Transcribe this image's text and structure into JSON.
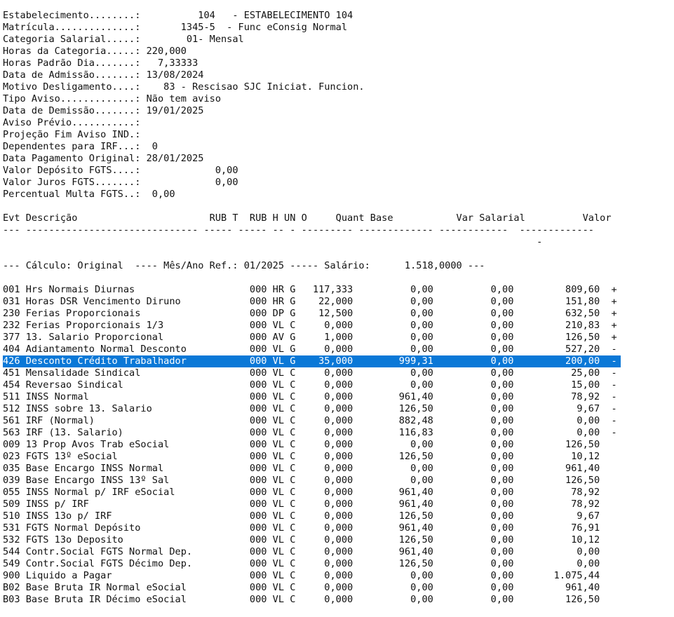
{
  "header_lines": [
    "Estabelecimento........:          104   - ESTABELECIMENTO 104",
    "Matrícula..............:       1345-5  - Func eConsig Normal",
    "Categoria Salarial.....:        01- Mensal",
    "Horas da Categoria.....: 220,000",
    "Horas Padrão Dia.......:   7,33333",
    "Data de Admissão.......: 13/08/2024",
    "Motivo Desligamento....:    83 - Rescisao SJC Iniciat. Funcion.",
    "Tipo Aviso.............: Não tem aviso",
    "Data de Demissão.......: 19/01/2025",
    "Aviso Prévio...........:",
    "Projeção Fim Aviso IND.:",
    "Dependentes para IRF...:  0",
    "Data Pagamento Original: 28/01/2025",
    "Valor Depósito FGTS....:             0,00",
    "Valor Juros FGTS.......:             0,00",
    "Percentual Multa FGTS..:  0,00"
  ],
  "blank_after_header": "",
  "column_header": "Evt Descrição                       RUB T  RUB H UN O     Quant Base           Var Salarial          Valor",
  "column_rule": "--- ------------------------------ ----- ----- -- - --------- ------------- ------------  -------------",
  "rule_tail": "                                                                                             -",
  "blank_before_calc": "",
  "calc_line": "--- Cálculo: Original  ---- Mês/Ano Ref.: 01/2025 ----- Salário:      1.518,0000 ---",
  "blank_after_calc": "",
  "rows": [
    {
      "text": "001 Hrs Normais Diurnas                    000 HR G   117,333          0,00          0,00         809,60  +",
      "selected": false
    },
    {
      "text": "031 Horas DSR Vencimento Diruno            000 HR G    22,000          0,00          0,00         151,80  +",
      "selected": false
    },
    {
      "text": "230 Ferias Proporcionais                   000 DP G    12,500          0,00          0,00         632,50  +",
      "selected": false
    },
    {
      "text": "232 Ferias Proporcionais 1/3               000 VL C     0,000          0,00          0,00         210,83  +",
      "selected": false
    },
    {
      "text": "377 13. Salario Proporcional               000 AV G     1,000          0,00          0,00         126,50  +",
      "selected": false
    },
    {
      "text": "404 Adiantamento Normal Desconto           000 VL G     0,000          0,00          0,00         527,20  -",
      "selected": false
    },
    {
      "text": "426 Desconto Crédito Trabalhador           000 VL G    35,000        999,31          0,00         200,00  -",
      "selected": true
    },
    {
      "text": "451 Mensalidade Sindical                   000 VL C     0,000          0,00          0,00          25,00  -",
      "selected": false
    },
    {
      "text": "454 Reversao Sindical                      000 VL C     0,000          0,00          0,00          15,00  -",
      "selected": false
    },
    {
      "text": "511 INSS Normal                            000 VL C     0,000        961,40          0,00          78,92  -",
      "selected": false
    },
    {
      "text": "512 INSS sobre 13. Salario                 000 VL C     0,000        126,50          0,00           9,67  -",
      "selected": false
    },
    {
      "text": "561 IRF (Normal)                           000 VL C     0,000        882,48          0,00           0,00  -",
      "selected": false
    },
    {
      "text": "563 IRF (13. Salario)                      000 VL C     0,000        116,83          0,00           0,00  -",
      "selected": false
    },
    {
      "text": "009 13 Prop Avos Trab eSocial              000 VL C     0,000          0,00          0,00         126,50",
      "selected": false
    },
    {
      "text": "023 FGTS 13º eSocial                       000 VL C     0,000        126,50          0,00          10,12",
      "selected": false
    },
    {
      "text": "035 Base Encargo INSS Normal               000 VL C     0,000          0,00          0,00         961,40",
      "selected": false
    },
    {
      "text": "039 Base Encargo INSS 13º Sal              000 VL C     0,000          0,00          0,00         126,50",
      "selected": false
    },
    {
      "text": "055 INSS Normal p/ IRF eSocial             000 VL C     0,000        961,40          0,00          78,92",
      "selected": false
    },
    {
      "text": "509 INSS p/ IRF                            000 VL C     0,000        961,40          0,00          78,92",
      "selected": false
    },
    {
      "text": "510 INSS 13o p/ IRF                        000 VL C     0,000        126,50          0,00           9,67",
      "selected": false
    },
    {
      "text": "531 FGTS Normal Depósito                   000 VL C     0,000        961,40          0,00          76,91",
      "selected": false
    },
    {
      "text": "532 FGTS 13o Deposito                      000 VL C     0,000        126,50          0,00          10,12",
      "selected": false
    },
    {
      "text": "544 Contr.Social FGTS Normal Dep.          000 VL C     0,000        961,40          0,00           0,00",
      "selected": false
    },
    {
      "text": "549 Contr.Social FGTS Décimo Dep.          000 VL C     0,000        126,50          0,00           0,00",
      "selected": false
    },
    {
      "text": "900 Liquido a Pagar                        000 VL C     0,000          0,00          0,00       1.075,44",
      "selected": false
    },
    {
      "text": "B02 Base Bruta IR Normal eSocial           000 VL C     0,000          0,00          0,00         961,40",
      "selected": false
    },
    {
      "text": "B03 Base Bruta IR Décimo eSocial           000 VL C     0,000          0,00          0,00         126,50",
      "selected": false
    }
  ],
  "colors": {
    "background": "#ffffff",
    "text": "#111111",
    "selection_background": "#0a78d7",
    "selection_text": "#ffffff"
  }
}
